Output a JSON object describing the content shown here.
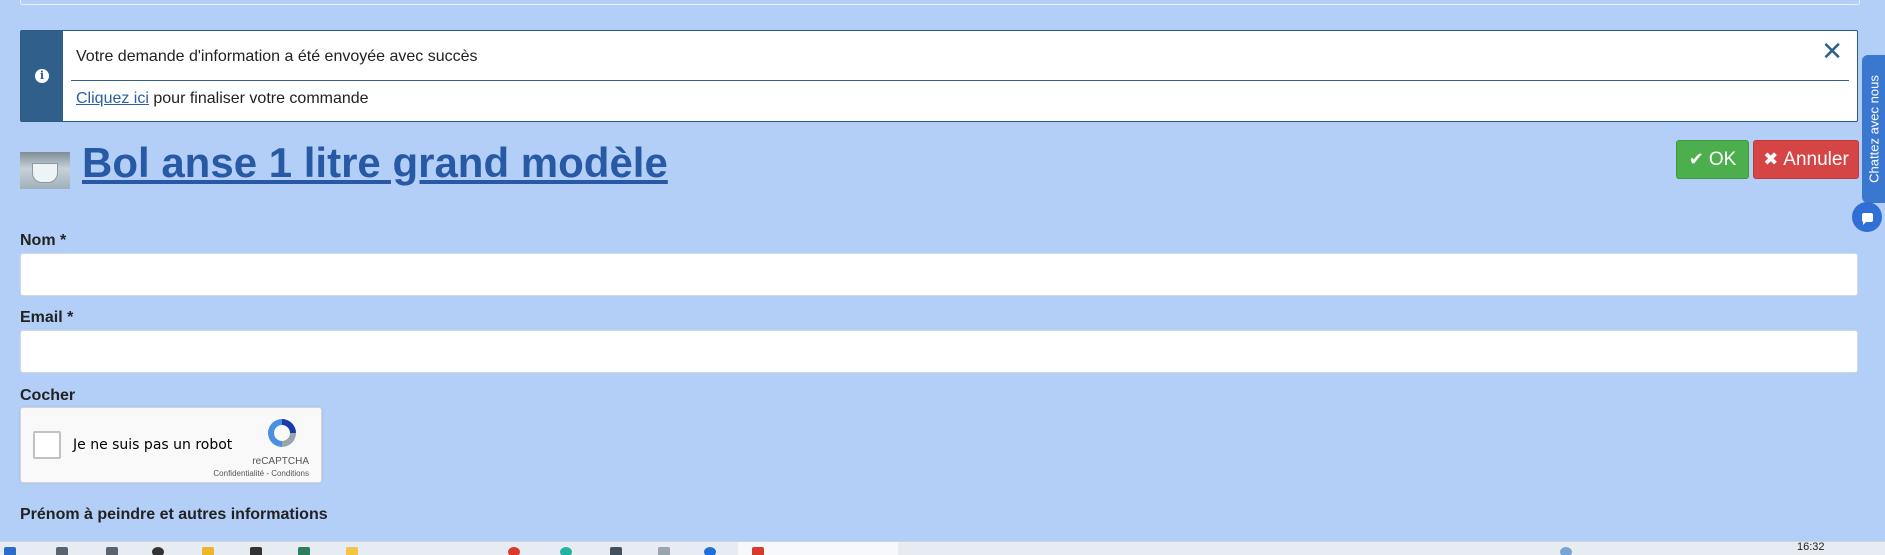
{
  "alert": {
    "message": "Votre demande d'information a été envoyée avec succès",
    "link_text": "Cliquez ici",
    "link_suffix": " pour finaliser votre commande",
    "close_symbol": "✕"
  },
  "product": {
    "title": "Bol anse 1 litre grand modèle"
  },
  "actions": {
    "ok_label": "OK",
    "ok_icon": "check-icon",
    "cancel_label": "Annuler",
    "cancel_icon": "close-icon"
  },
  "chat": {
    "tab_label": "Chattez avec nous",
    "bubble_icon": "chat-bubble-icon"
  },
  "form": {
    "name_label": "Nom *",
    "name_value": "",
    "email_label": "Email *",
    "email_value": "",
    "captcha_label": "Cocher",
    "recaptcha": {
      "checkbox_text": "Je ne suis pas un robot",
      "brand": "reCAPTCHA",
      "terms": "Confidentialité - Conditions"
    },
    "extra_label": "Prénom à peindre et autres informations"
  },
  "taskbar": {
    "time": "16:32"
  },
  "colors": {
    "page_bg": "#b3cff7",
    "alert_accent": "#2f5f8a",
    "title_link": "#2859a5",
    "ok_green": "#4cae4c",
    "cancel_red": "#d64545",
    "chat_blue": "#3a78d0"
  }
}
